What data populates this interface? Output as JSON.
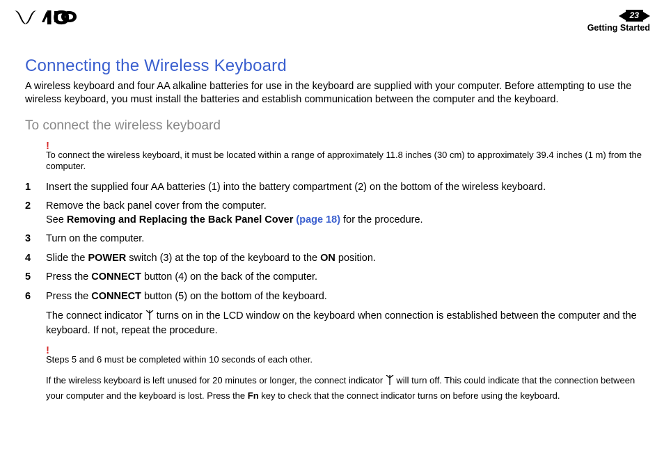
{
  "header": {
    "page_number": "23",
    "section": "Getting Started"
  },
  "title": "Connecting the Wireless Keyboard",
  "intro": "A wireless keyboard and four AA alkaline batteries for use in the keyboard are supplied with your computer. Before attempting to use the wireless keyboard, you must install the batteries and establish communication between the computer and the keyboard.",
  "subtitle": "To connect the wireless keyboard",
  "alert1": "To connect the wireless keyboard, it must be located within a range of approximately 11.8 inches (30 cm) to approximately 39.4 inches (1 m) from the computer.",
  "steps": {
    "s1": {
      "n": "1",
      "text": "Insert the supplied four AA batteries (1) into the battery compartment (2) on the bottom of the wireless keyboard."
    },
    "s2": {
      "n": "2",
      "line1": "Remove the back panel cover from the computer.",
      "line2a": "See ",
      "line2b": "Removing and Replacing the Back Panel Cover ",
      "link": "(page 18)",
      "line2c": " for the procedure."
    },
    "s3": {
      "n": "3",
      "text": "Turn on the computer."
    },
    "s4": {
      "n": "4",
      "a": "Slide the ",
      "b": "POWER",
      "c": " switch (3) at the top of the keyboard to the ",
      "d": "ON",
      "e": " position."
    },
    "s5": {
      "n": "5",
      "a": "Press the ",
      "b": "CONNECT",
      "c": " button (4) on the back of the computer."
    },
    "s6": {
      "n": "6",
      "a": "Press the ",
      "b": "CONNECT",
      "c": " button (5) on the bottom of the keyboard."
    }
  },
  "follow1a": "The connect indicator ",
  "follow1b": " turns on in the LCD window on the keyboard when connection is established between the computer and the keyboard. If not, repeat the procedure.",
  "alert2": "Steps 5 and 6 must be completed within 10 seconds of each other.",
  "note2a": "If the wireless keyboard is left unused for 20 minutes or longer, the connect indicator ",
  "note2b": " will turn off. This could indicate that the connection between your computer and the keyboard is lost. Press the ",
  "note2c": "Fn",
  "note2d": " key to check that the connect indicator turns on before using the keyboard."
}
